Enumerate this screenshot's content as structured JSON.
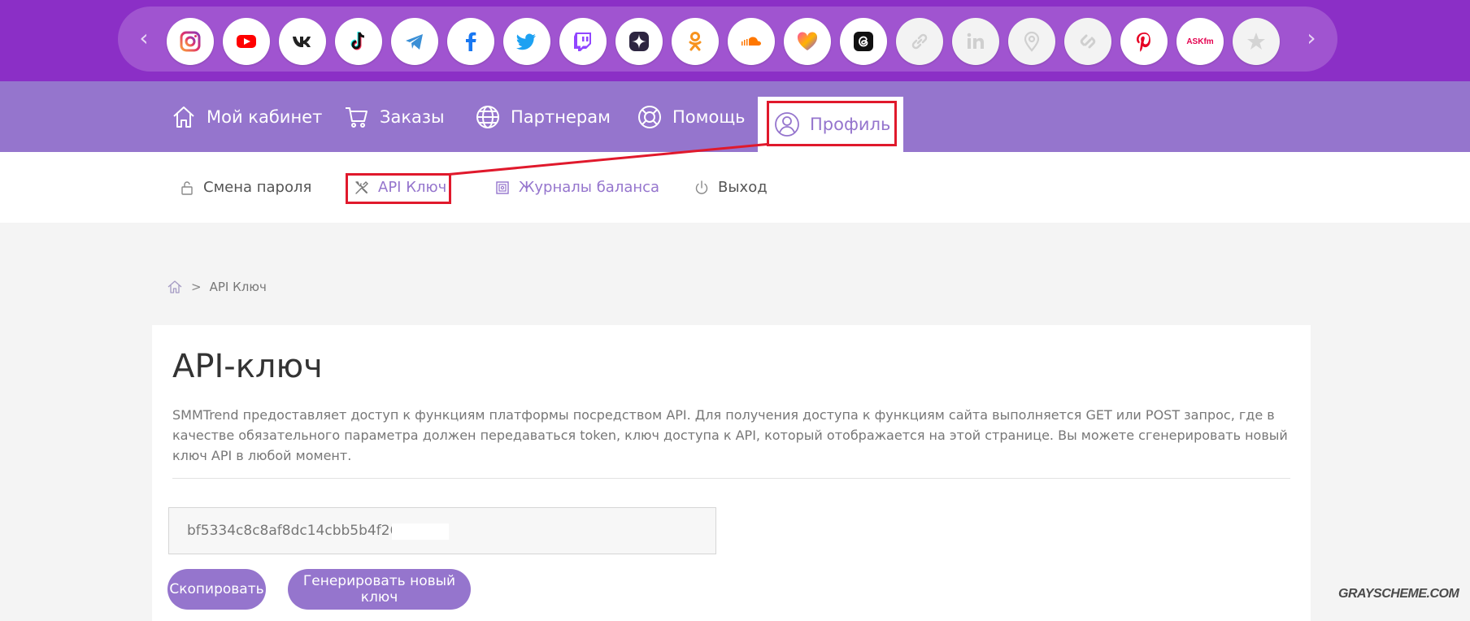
{
  "social_bar": {
    "icons": [
      "instagram-icon",
      "youtube-icon",
      "vk-icon",
      "tiktok-icon",
      "telegram-icon",
      "facebook-icon",
      "twitter-icon",
      "twitch-icon",
      "zen-icon",
      "odnoklassniki-icon",
      "soundcloud-icon",
      "likee-icon",
      "threads-icon",
      "link-icon",
      "linkedin-icon",
      "location-icon",
      "shazam-icon",
      "pinterest-icon",
      "askfm-icon",
      "star-icon"
    ],
    "askfm_label": "ASKfm",
    "prev_arrow": "‹",
    "next_arrow": "›"
  },
  "main_nav": {
    "items": [
      {
        "label": "Мой кабинет",
        "icon": "home-icon"
      },
      {
        "label": "Заказы",
        "icon": "cart-icon"
      },
      {
        "label": "Партнерам",
        "icon": "globe-icon"
      },
      {
        "label": "Помощь",
        "icon": "lifebuoy-icon"
      },
      {
        "label": "Профиль",
        "icon": "user-icon",
        "active": true
      }
    ]
  },
  "sub_nav": {
    "items": [
      {
        "label": "Смена пароля",
        "icon": "lock-icon"
      },
      {
        "label": "API Ключ",
        "icon": "tools-icon",
        "active": true
      },
      {
        "label": "Журналы баланса",
        "icon": "safe-icon"
      },
      {
        "label": "Выход",
        "icon": "power-icon"
      }
    ]
  },
  "breadcrumb": {
    "separator": ">",
    "current": "API Ключ"
  },
  "content": {
    "title": "API-ключ",
    "description": "SMMTrend предоставляет доступ к функциям платформы посредством API. Для получения доступа к функциям сайта выполняется GET или POST запрос, где в качестве обязательного параметра должен передаваться token, ключ доступа к API, который отображается на этой странице. Вы можете сгенерировать новый ключ API в любой момент.",
    "api_key_value": "bf5334c8c8af8dc14cbb5b4f263",
    "copy_button": "Скопировать",
    "generate_button": "Генерировать новый ключ"
  },
  "watermark": "GRAYSCHEME.COM",
  "colors": {
    "top_bar": "#8b2fc6",
    "nav_bar": "#9575cd",
    "accent": "#9575cd",
    "highlight": "#e0192c",
    "background": "#f4f4f4"
  }
}
